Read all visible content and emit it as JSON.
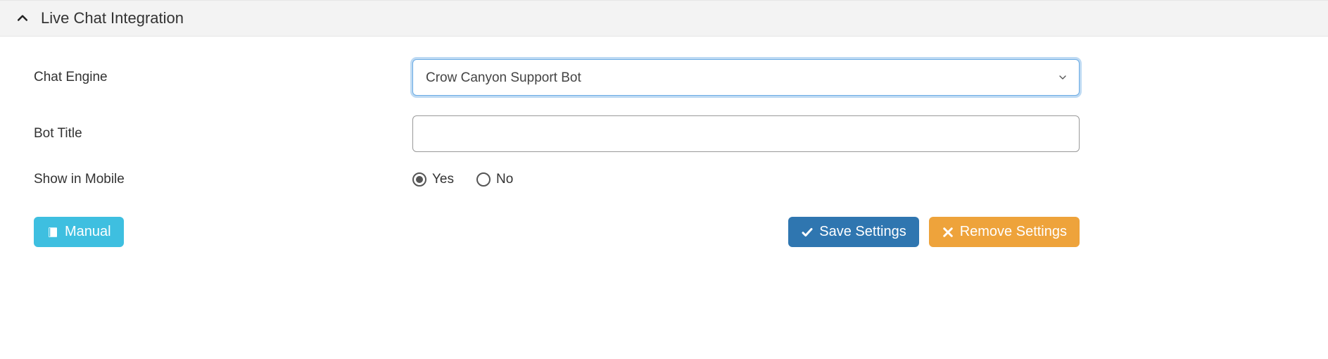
{
  "panel": {
    "title": "Live Chat Integration"
  },
  "form": {
    "chat_engine": {
      "label": "Chat Engine",
      "selected": "Crow Canyon Support Bot"
    },
    "bot_title": {
      "label": "Bot Title",
      "value": ""
    },
    "show_in_mobile": {
      "label": "Show in Mobile",
      "options": {
        "yes": "Yes",
        "no": "No"
      },
      "selected": "yes"
    }
  },
  "buttons": {
    "manual": "Manual",
    "save": "Save Settings",
    "remove": "Remove Settings"
  }
}
